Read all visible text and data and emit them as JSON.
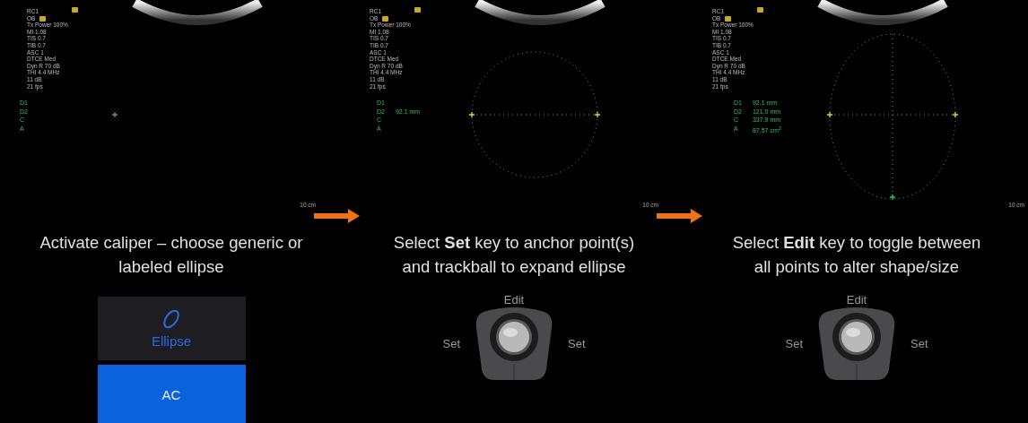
{
  "steps": [
    {
      "screen": {
        "params": [
          "RC1",
          "OB",
          "Tx Power 100%",
          "MI 1.08",
          "TIS 0.7",
          "TIB 0.7",
          "ASC 1",
          "DTCE Med",
          "Dyn R 70 dB",
          "THI 4.4 MHz",
          "11 dB",
          "21 fps"
        ],
        "scale": "10 cm",
        "kind": "crosshair",
        "measurements": [
          {
            "label": "D1"
          },
          {
            "label": "D2"
          },
          {
            "label": "C"
          },
          {
            "label": "A"
          }
        ]
      },
      "caption_lines": [
        "Activate caliper – choose generic or",
        "labeled ellipse"
      ],
      "control": {
        "kind": "buttons",
        "buttons": [
          {
            "label": "Ellipse",
            "selected": false
          },
          {
            "label": "AC",
            "selected": true
          }
        ]
      }
    },
    {
      "screen": {
        "params": [
          "RC1",
          "OB",
          "Tx Power 100%",
          "MI 1.08",
          "TIS 0.7",
          "TIB 0.7",
          "ASC 1",
          "DTCE Med",
          "Dyn R 70 dB",
          "THI 4.4 MHz",
          "11 dB",
          "21 fps"
        ],
        "scale": "10 cm",
        "kind": "circle",
        "measurements": [
          {
            "label": "D1"
          },
          {
            "label": "D2",
            "value": "92.1 mm"
          },
          {
            "label": "C"
          },
          {
            "label": "A"
          }
        ]
      },
      "caption_lines": [
        "Select **Set** key to anchor point(s)",
        "and trackball to expand ellipse"
      ],
      "control": {
        "kind": "trackball",
        "top": "Edit",
        "left": "Set",
        "right": "Set"
      }
    },
    {
      "screen": {
        "params": [
          "RC1",
          "OB",
          "Tx Power 100%",
          "MI 1.08",
          "TIS 0.7",
          "TIB 0.7",
          "ASC 1",
          "DTCE Med",
          "Dyn R 70 dB",
          "THI 4.4 MHz",
          "11 dB",
          "21 fps"
        ],
        "scale": "10 cm",
        "kind": "ellipse",
        "measurements": [
          {
            "label": "D1",
            "value": "92.1 mm"
          },
          {
            "label": "D2",
            "value": "121.0 mm"
          },
          {
            "label": "C",
            "value": "337.9 mm"
          },
          {
            "label": "A",
            "value": "87.57 cm$^{2}$"
          }
        ]
      },
      "caption_lines": [
        "Select **Edit** key to toggle between",
        "all points to alter shape/size"
      ],
      "control": {
        "kind": "trackball",
        "top": "Edit",
        "left": "Set",
        "right": "Set"
      }
    }
  ]
}
